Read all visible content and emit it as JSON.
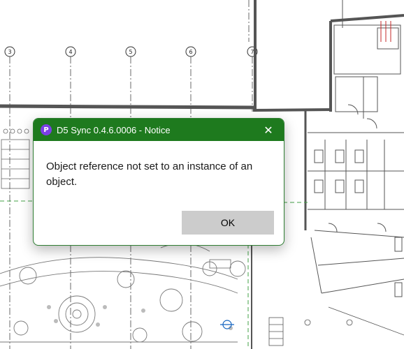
{
  "background": {
    "grid_labels": [
      "3",
      "4",
      "5",
      "6",
      "7"
    ]
  },
  "dialog": {
    "title": "D5 Sync 0.4.6.0006 - Notice",
    "icon_letter": "P",
    "message": "Object reference not set to an instance of an object.",
    "ok_label": "OK",
    "close_glyph": "✕",
    "title_bar_color": "#1e7a1e",
    "icon_color": "#7b3fe4"
  }
}
